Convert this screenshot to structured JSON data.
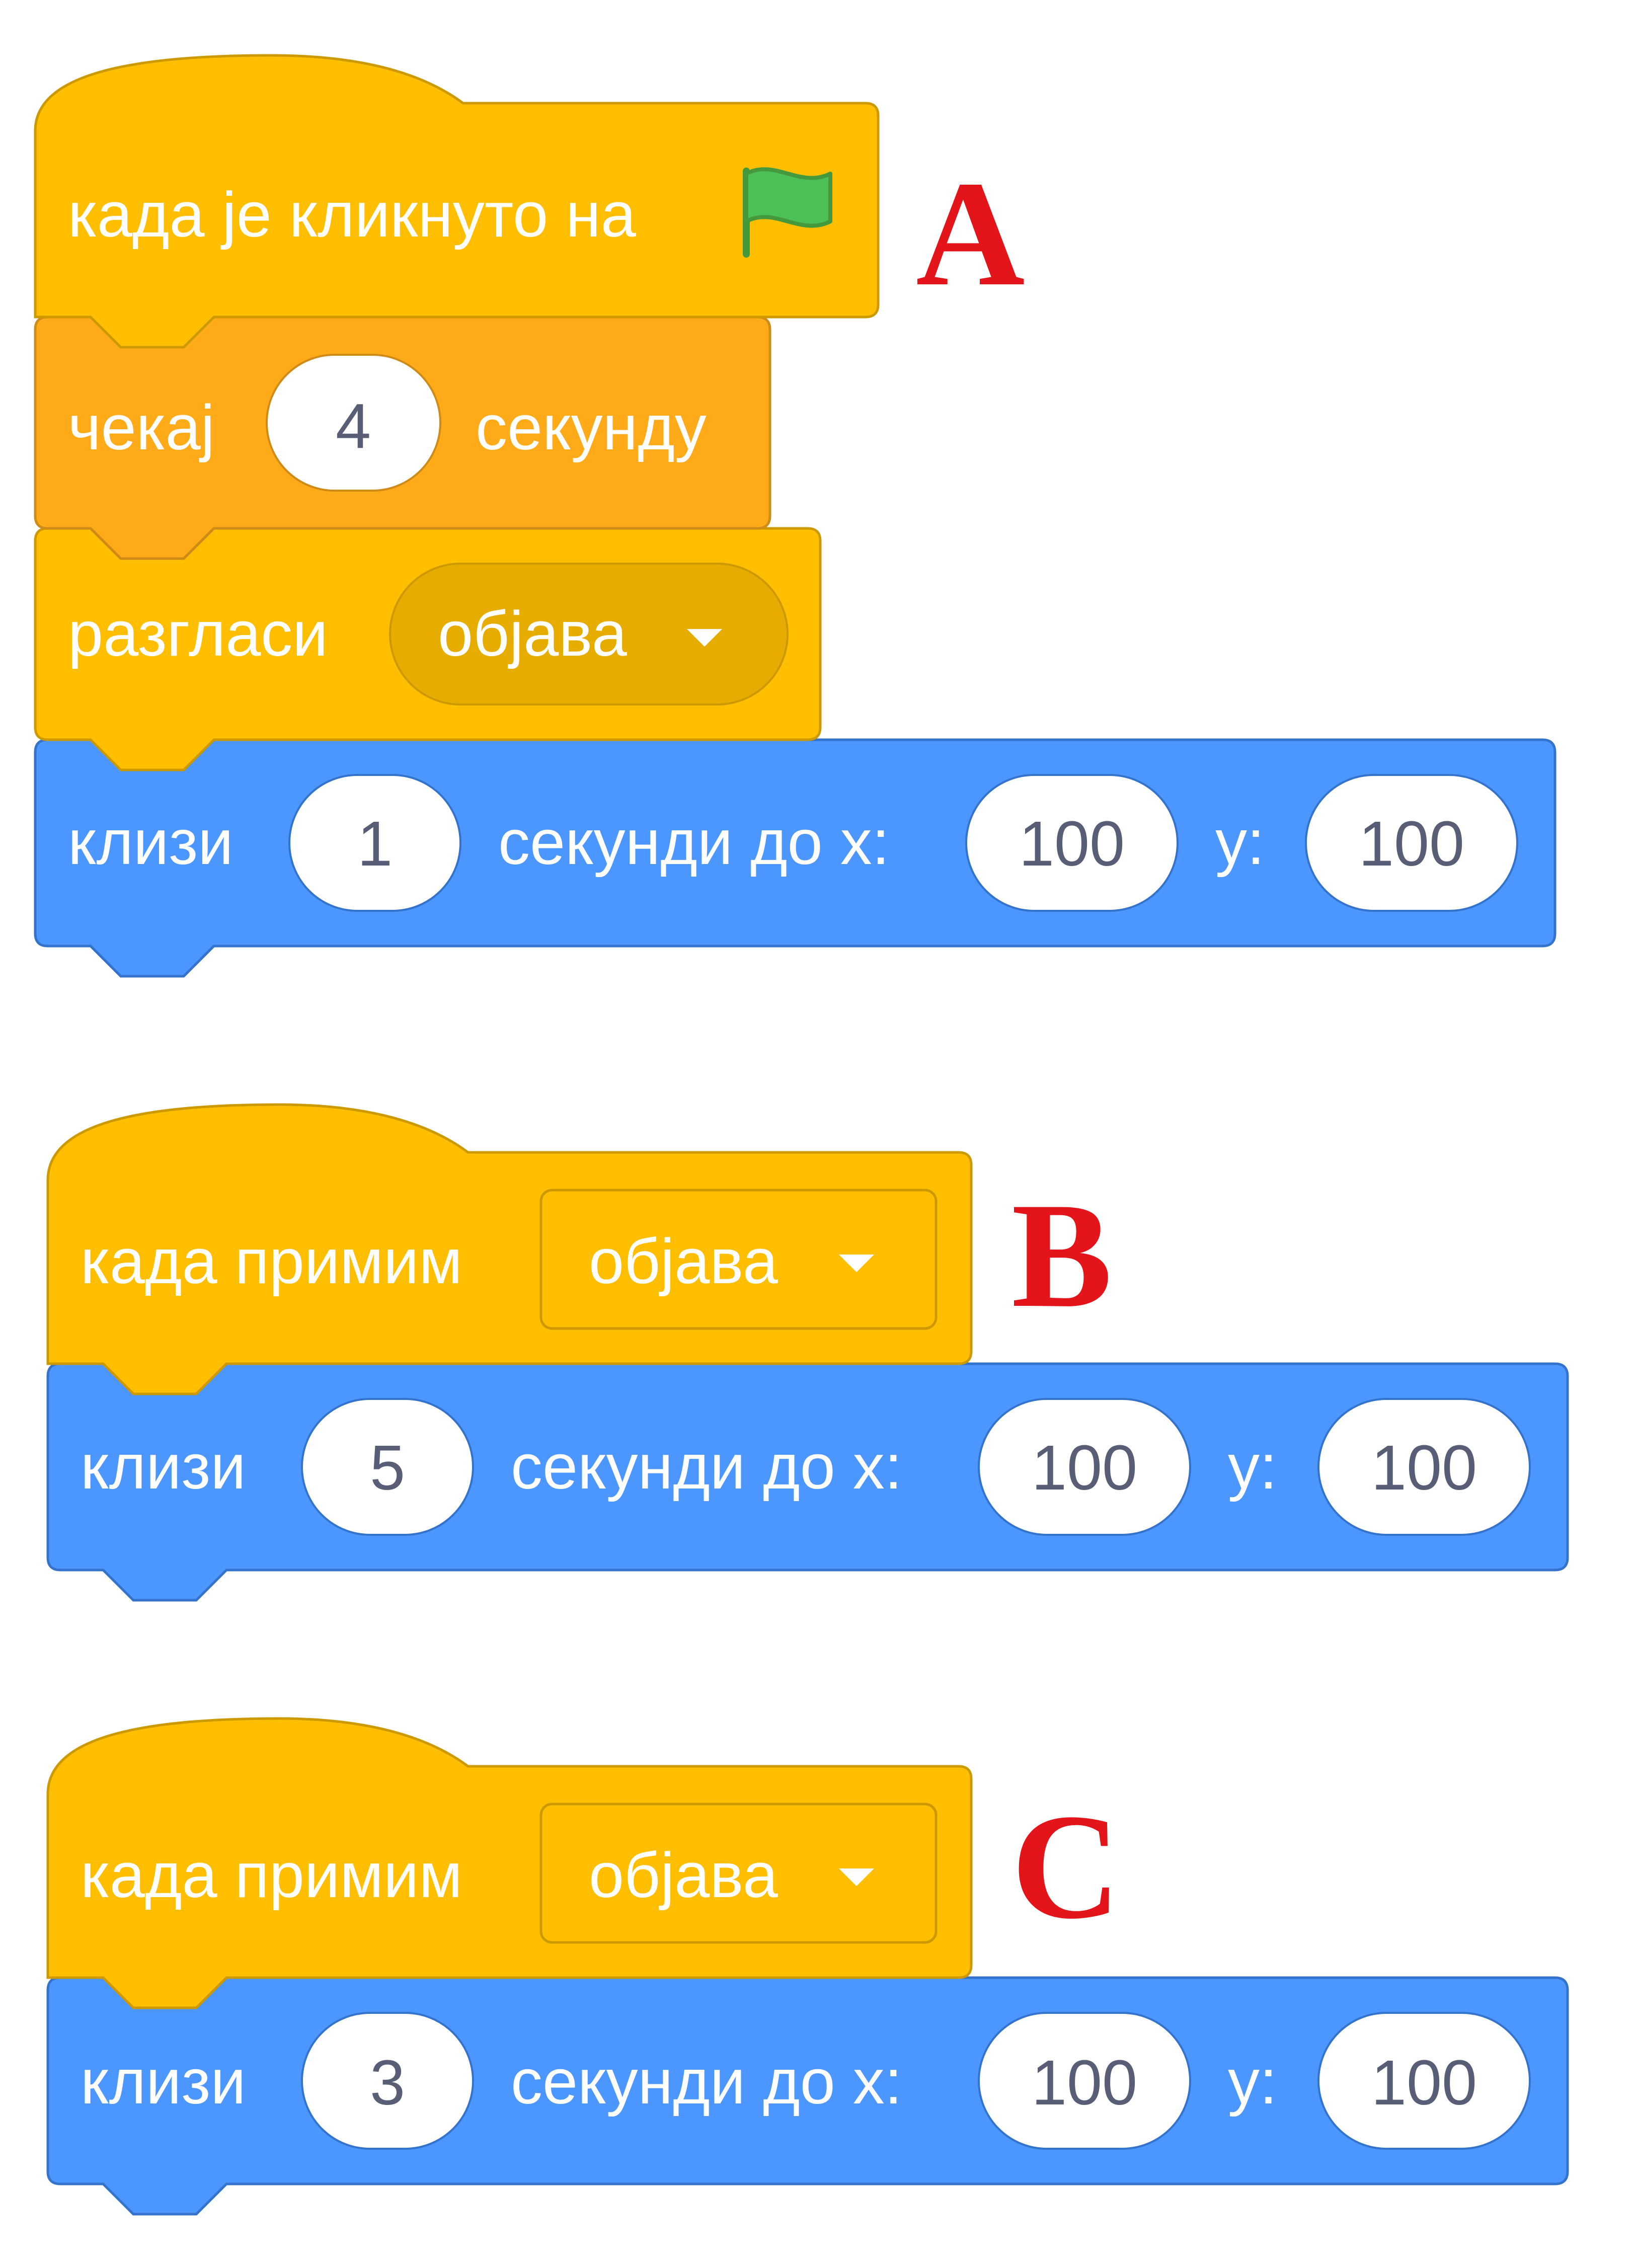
{
  "colors": {
    "events": "#ffbf00",
    "events_border": "#cc9900",
    "events_dark": "#e6ac00",
    "control": "#ffab19",
    "control_border": "#cf8b17",
    "motion": "#4c97ff",
    "motion_border": "#3373cc",
    "field_text": "#575e75",
    "label_red": "#e3151a",
    "flag_green": "#4cbf56"
  },
  "scripts": [
    {
      "label": "A",
      "hat": {
        "text": "када је кликнуто на",
        "icon": "green-flag-icon"
      },
      "wait": {
        "prefix": "чекај",
        "value": "4",
        "suffix": "секунду"
      },
      "broadcast": {
        "prefix": "разгласи",
        "option": "објава"
      },
      "glide": {
        "prefix": "клизи",
        "secs": "1",
        "mid": "секунди до x:",
        "x": "100",
        "ylabel": "y:",
        "y": "100"
      }
    },
    {
      "label": "B",
      "hat": {
        "text": "када примим",
        "option": "објава"
      },
      "glide": {
        "prefix": "клизи",
        "secs": "5",
        "mid": "секунди до x:",
        "x": "100",
        "ylabel": "y:",
        "y": "100"
      }
    },
    {
      "label": "C",
      "hat": {
        "text": "када примим",
        "option": "објава"
      },
      "glide": {
        "prefix": "клизи",
        "secs": "3",
        "mid": "секунди до x:",
        "x": "100",
        "ylabel": "y:",
        "y": "100"
      }
    }
  ]
}
